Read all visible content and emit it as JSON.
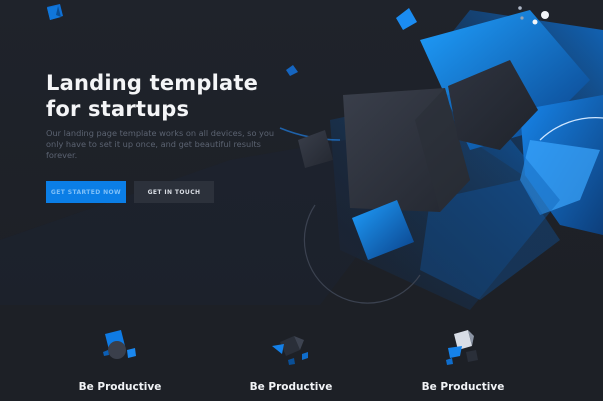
{
  "hero": {
    "title": "Landing template for startups",
    "paragraph": "Our landing page template works on all devices, so you only have to set it up once, and get beautiful results forever.",
    "primary_button": "GET STARTED NOW",
    "secondary_button": "GET IN TOUCH"
  },
  "features": [
    {
      "title": "Be Productive",
      "icon": "cube-cluster-icon"
    },
    {
      "title": "Be Productive",
      "icon": "cube-cluster-icon"
    },
    {
      "title": "Be Productive",
      "icon": "cube-cluster-icon"
    }
  ],
  "colors": {
    "background": "#1d2026",
    "accent": "#0b7ee6",
    "secondary_button": "#2c313b",
    "muted_text": "#5b6371"
  }
}
